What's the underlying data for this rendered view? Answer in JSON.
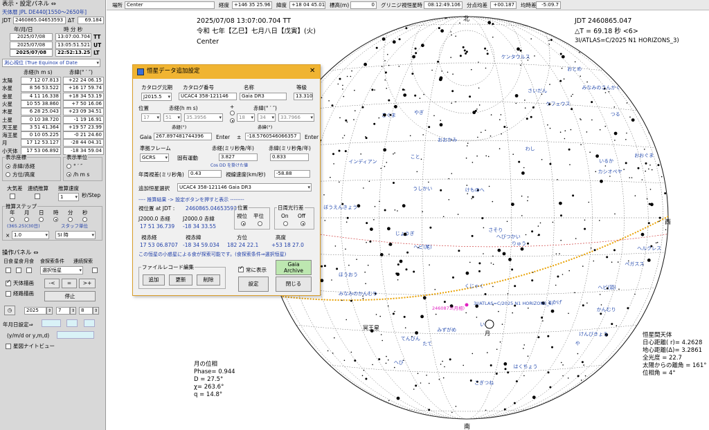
{
  "top_bar": {
    "location_label": "場所",
    "location_value": "Center",
    "longitude_label": "経度",
    "longitude_value": "+146 35 25.96",
    "latitude_label": "緯度",
    "latitude_value": "+18 04 45.01",
    "altitude_label": "標高(m)",
    "altitude_value": "0",
    "gst_label": "グリニジ視恒星時",
    "gst_value": "08:12:49.106",
    "equinox_label": "分点均差",
    "equinox_value": "+00.187",
    "eqtime_label": "均時差",
    "eqtime_value": "-5:09.7"
  },
  "left_panel": {
    "title": "表示・設定パネル ⇔",
    "ephemeris": "天体暦 JPL DE440[1550～2650年]",
    "jdt_label": "JDT",
    "jdt_value": "2460865.04653593",
    "dt_label": "ΔT",
    "dt_value": "69.184",
    "date_header": "年/月/日",
    "time_header": "時 分 秒",
    "rows": [
      {
        "date": "2025/07/08",
        "time": "13:07:00.704",
        "sys": "TT"
      },
      {
        "date": "2025/07/08",
        "time": "13:05:51.521",
        "sys": "UT"
      },
      {
        "date": "2025/07/08",
        "time": "22:52:13.251",
        "sys": "LT"
      }
    ],
    "coord_select": "測心視位 (True Equinox of Date",
    "ra_header": "赤経(h m s)",
    "dec_header": "赤緯(° ′ ″)",
    "bodies": [
      {
        "name": "太陽",
        "ra": "7 12 07.813",
        "dec": "+22 24 06.15"
      },
      {
        "name": "水星",
        "ra": "8 56 53.522",
        "dec": "+16 17 59.74"
      },
      {
        "name": "金星",
        "ra": "4 11 16.338",
        "dec": "+18 34 53.19"
      },
      {
        "name": "火星",
        "ra": "10 55 38.860",
        "dec": "+7 50 16.06"
      },
      {
        "name": "木星",
        "ra": "6 28 25.043",
        "dec": "+23 09 34.51"
      },
      {
        "name": "土星",
        "ra": "0 10 38.720",
        "dec": "-1 19 16.91"
      },
      {
        "name": "天王星",
        "ra": "3 51 41.364",
        "dec": "+19 57 23.99"
      },
      {
        "name": "海王星",
        "ra": "0 10 05.225",
        "dec": "-0 21 24.60"
      },
      {
        "name": "月",
        "ra": "17 12 53.127",
        "dec": "-28 44 04.31"
      },
      {
        "name": "小天体",
        "ra": "17 53 06.892",
        "dec": "-18 34 59.04"
      }
    ],
    "display_coord_title": "表示座標",
    "coord_opt1": "赤緯/赤経",
    "coord_opt2": "方位/高度",
    "display_unit_title": "表示単位",
    "unit_opt1": "°  ′  ″",
    "unit_opt2": "/h m s",
    "atm_label": "大気差",
    "cont_label": "連続推算",
    "speed_title": "推算速度",
    "speed_value": "1",
    "speed_unit": "秒/Step",
    "step_title": "推算ステップ",
    "step_units": [
      "年",
      "月",
      "日",
      "時",
      "分",
      "秒"
    ],
    "step_note": "(365.25)(30日)",
    "step_unit_label": "スタッフ単位",
    "step_mult": "1.0",
    "step_type": "SI 時",
    "op_title": "操作パネル ⇔",
    "op_labels": [
      "日食",
      "星食",
      "月食"
    ],
    "condition_label": "食探索条件",
    "search_label": "連続探索",
    "search_select": "選択恒星",
    "sky_draw": "天体描画",
    "track_draw": "経路描画",
    "stop": "停止",
    "date_year": "2025",
    "date_month": "7",
    "date_day": "8",
    "set_date_label": "年月日設定⇒",
    "ymd_label": "(y/m/d or y,m,d)",
    "night_view": "星図ナイトビュー"
  },
  "chart": {
    "date_line": "2025/07/08        13:07:00.704 TT",
    "jp_date": "令和 七年【乙巳】七月八日【戊寅】(火)",
    "place": "Center",
    "jdt": "JDT 2460865.047",
    "dt": "△T = 69.18  秒  <6>",
    "object": "3I/ATLAS=C/2025 N1 HORIZONS_3)",
    "north": "北",
    "south": "南",
    "west": "西",
    "moon_label": "月",
    "neptune_label": "冥王星",
    "marker_label": "3I/ATLAS=C/2025 N1 HORIZONS_3)",
    "marker_label2": "2460873(月相)",
    "moon_pos_title": "月の位相",
    "moon_phase": "Phase= 0.944",
    "moon_d": "D =    27.5°",
    "moon_chi": "χ=   263.6°",
    "moon_q": "q =   14.8°",
    "body_title": "恒星間天体",
    "body_r": "日心距離( r)= 4.2628",
    "body_delta": "地心距離(Δ)= 3.2861",
    "body_mag": "全光度          = 22.7",
    "body_elong": "太陽からの離角 = 161°",
    "body_phase": "位相角          = 4°",
    "constellations": [
      "りゅう",
      "こぐま",
      "おおぐま",
      "ヘルクレス",
      "かんむり",
      "うしかい",
      "へび",
      "へびつかい",
      "ヘビ(頭)",
      "ヘビ(尾)",
      "いて",
      "たて",
      "わし",
      "や",
      "こぎつね",
      "はくちょう",
      "こと",
      "けものへ",
      "てんびん",
      "おとめ",
      "さそり",
      "みなみのかんむり",
      "ぼうえんきょう",
      "じょうぎ",
      "さいだん",
      "インディアン",
      "みなみのさんかく",
      "おおかみ",
      "ケンタウルス",
      "とかげ",
      "ケフェウス",
      "カシオペヤ",
      "ペガスス",
      "いるか",
      "やぎ",
      "みずがめ",
      "けんびきょう",
      "つる",
      "ほうおう",
      "くじゃく"
    ]
  },
  "dialog": {
    "title": "恒星データ追加設定",
    "catalog_epoch_label": "カタログ元期",
    "catalog_epoch": "J2015.5",
    "catalog_no_label": "カタログ番号",
    "catalog_no": "UCAC4 358-121146",
    "name_label": "名称",
    "name": "Gaia DR3",
    "mag_label": "等級",
    "mag": "13.310",
    "pos_label": "位置",
    "ra_label": "赤経(h m s)",
    "dec_label": "赤緯(° ′ ″)",
    "ra_h": "17",
    "ra_m": "51",
    "ra_s": "35.3956",
    "dec_d": "18",
    "dec_m": "34",
    "dec_s": "33.7966",
    "ra_unit": "赤経(°)",
    "dec_unit": "赤緯(°)",
    "gaia_label": "Gaia",
    "gaia_ra": "267.897481744396",
    "enter1": "Enter",
    "pm_sym": "±",
    "gaia_dec": "-18.5760546066357",
    "enter2": "Enter",
    "frame_label": "準拠フレーム",
    "frame": "GCRS",
    "propmotion_label": "固有運動",
    "pm_ra_label": "赤経(ミリ秒角/年)",
    "pm_ra": "3.827",
    "pm_dec_label": "赤緯(ミリ秒角/年)",
    "pm_dec": "0.833",
    "cosdelta_note": "Cos DD を掛けた値",
    "parallax_label": "年周視差(ミリ秒角)",
    "parallax": "0.43",
    "radvel_label": "視線速度(km/秒)",
    "radvel": "-58.88",
    "add_star_label": "追加恒星選択",
    "add_star": "UCAC4 358-121146   Gaia DR3",
    "result_header": "---- 推算結果 -> 設定ボタンを押すと表示 --------",
    "apparent_jdt_label": "視位置 at JDT :",
    "apparent_jdt": "2460865.04653593",
    "j2000_ra_label": "J2000.0 赤経",
    "j2000_ra": "17 51 36.739",
    "j2000_dec_label": "J2000.0 赤緯",
    "j2000_dec": "-18 34 33.55",
    "position_title": "位置",
    "pos_opt1": "視位",
    "pos_opt2": "平位",
    "daylight_title": "日周光行差",
    "dl_on": "On",
    "dl_off": "Off",
    "app_ra_label": "視赤経",
    "app_ra": "17 53 06.8707",
    "app_dec_label": "視赤緯",
    "app_dec": "-18 34 59.034",
    "azimuth_label": "方位",
    "azimuth": "182 24 22.1",
    "altitude_label": "高度",
    "altitude": "+53 18 27.0",
    "note": "この恒星の小惑星による食が探索可能です。(食探索条件⇒選択恒星)",
    "file_group": "ファイルレコード編集",
    "btn_add": "追加",
    "btn_update": "更新",
    "btn_delete": "削除",
    "always_show": "常に表示",
    "gaia_archive": "Gaia Archive",
    "btn_set": "設定",
    "btn_close": "閉じる"
  },
  "colors": {
    "title_bar": "#f0b432",
    "ecliptic": "#e8a000",
    "equator": "#d04040",
    "label_blue": "#2a4fb0",
    "marker": "#e020c0"
  }
}
